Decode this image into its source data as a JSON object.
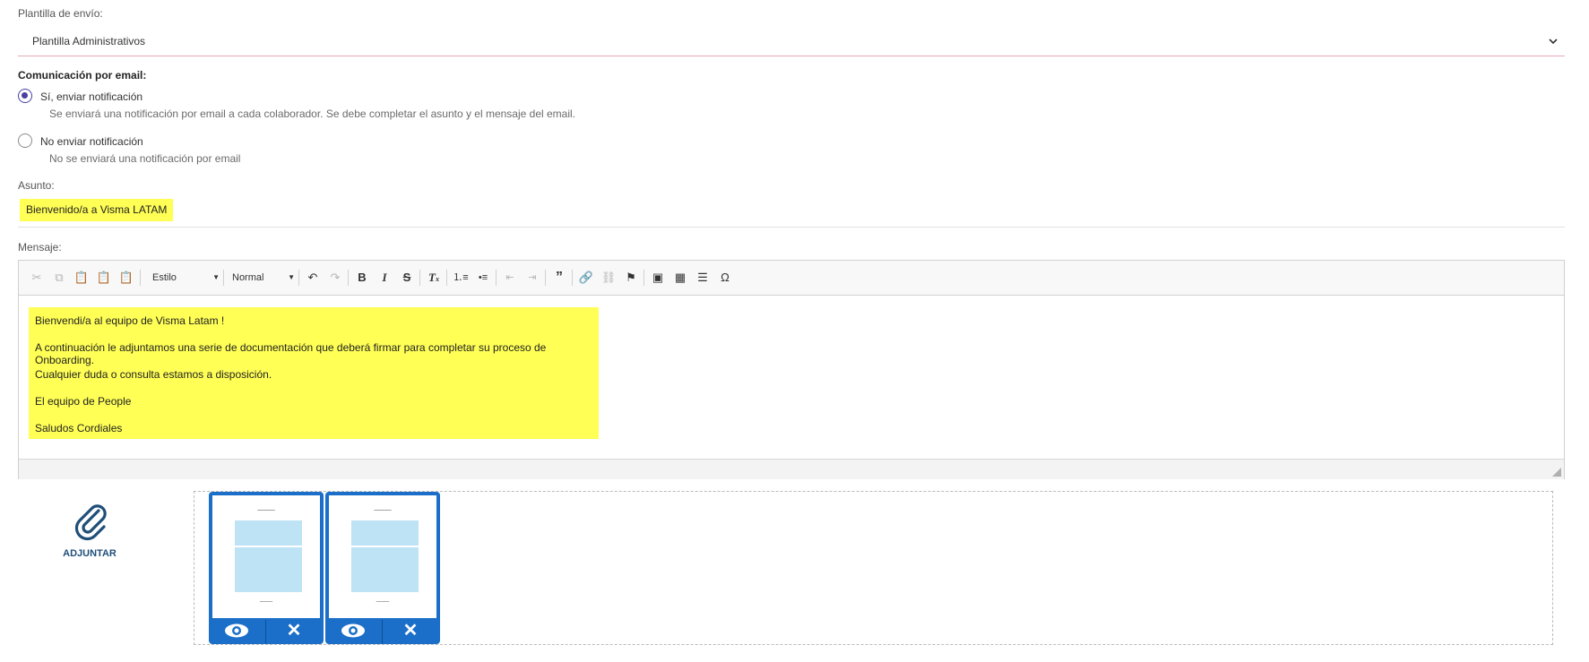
{
  "template": {
    "label": "Plantilla de envío:",
    "selected": "Plantilla Administrativos"
  },
  "email_comm": {
    "label": "Comunicación por email:",
    "options": [
      {
        "title": "Sí, enviar notificación",
        "desc": "Se enviará una notificación por email a cada colaborador. Se debe completar el asunto y el mensaje del email.",
        "checked": true
      },
      {
        "title": "No enviar notificación",
        "desc": "No se enviará una notificación por email",
        "checked": false
      }
    ]
  },
  "subject": {
    "label": "Asunto:",
    "value": "Bienvenido/a a Visma LATAM"
  },
  "message": {
    "label": "Mensaje:",
    "toolbar": {
      "style_combo": "Estilo",
      "format_combo": "Normal"
    },
    "lines": [
      "Bienvendi/a al equipo de Visma Latam !",
      "A continuación le adjuntamos una serie de documentación que deberá firmar para completar su proceso de Onboarding.",
      "Cualquier duda o consulta estamos a disposición.",
      "El equipo de People",
      "Saludos Cordiales"
    ]
  },
  "attachments": {
    "button_label": "ADJUNTAR",
    "count": 2
  },
  "colors": {
    "highlight": "#ffff55",
    "radio_accent": "#4b3fa0",
    "card_blue": "#1b6fc8",
    "attach_icon": "#1f4e79"
  }
}
